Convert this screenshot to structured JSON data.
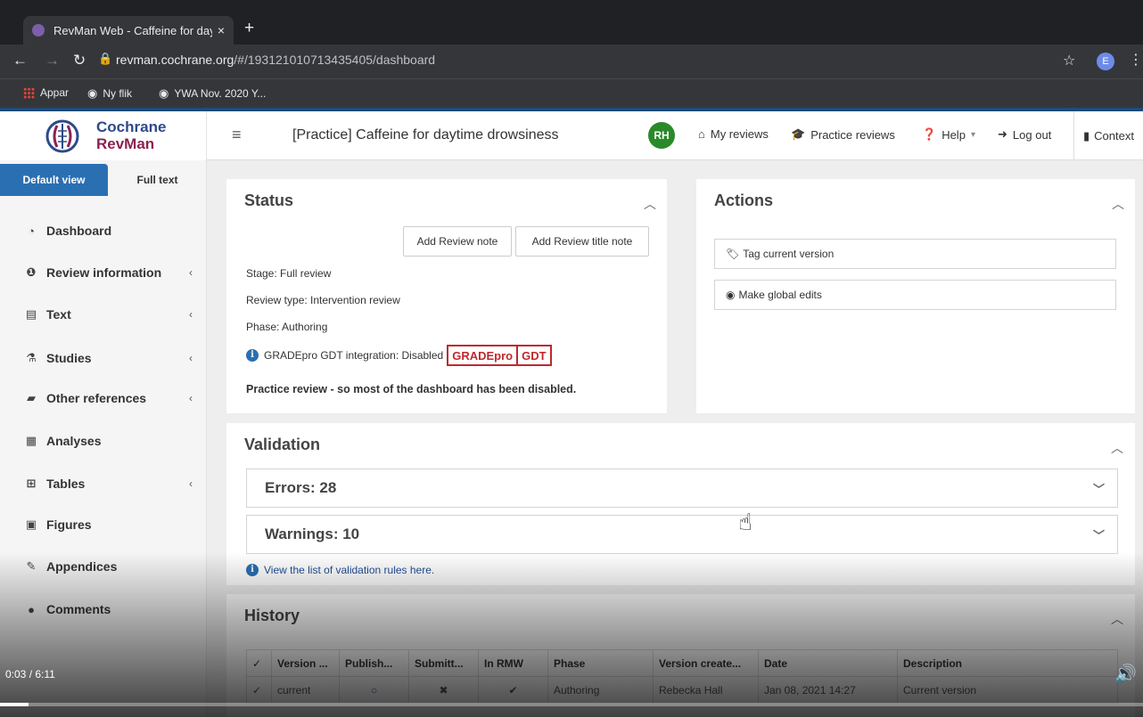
{
  "browser": {
    "tab_title": "RevMan Web - Caffeine for day",
    "tab_close": "×",
    "new_tab": "+",
    "url_host": "revman.cochrane.org",
    "url_path": "/#/193121010713435405/dashboard",
    "profile_initial": "E",
    "bookmarks": [
      "Appar",
      "Ny flik",
      "YWA Nov. 2020 Y..."
    ]
  },
  "header": {
    "logo_line1": "Cochrane",
    "logo_line2": "RevMan",
    "review_title": "[Practice] Caffeine for daytime drowsiness",
    "user_initials": "RH",
    "nav": {
      "my_reviews": "My reviews",
      "practice_reviews": "Practice reviews",
      "help": "Help",
      "logout": "Log out",
      "context": "Context"
    }
  },
  "sidebar": {
    "view_default": "Default view",
    "view_full": "Full text",
    "items": [
      {
        "label": "Dashboard",
        "icon": "dashboard-icon",
        "chevron": false
      },
      {
        "label": "Review information",
        "icon": "info-icon",
        "chevron": true
      },
      {
        "label": "Text",
        "icon": "file-icon",
        "chevron": true
      },
      {
        "label": "Studies",
        "icon": "flask-icon",
        "chevron": true
      },
      {
        "label": "Other references",
        "icon": "book-icon",
        "chevron": true
      },
      {
        "label": "Analyses",
        "icon": "calculator-icon",
        "chevron": false
      },
      {
        "label": "Tables",
        "icon": "table-icon",
        "chevron": true
      },
      {
        "label": "Figures",
        "icon": "image-icon",
        "chevron": false
      },
      {
        "label": "Appendices",
        "icon": "paperclip-icon",
        "chevron": false
      },
      {
        "label": "Comments",
        "icon": "comment-icon",
        "chevron": false
      }
    ]
  },
  "status": {
    "title": "Status",
    "add_note": "Add Review note",
    "add_title_note": "Add Review title note",
    "stage": "Stage: Full review",
    "review_type": "Review type: Intervention review",
    "phase": "Phase: Authoring",
    "gradepro": "GRADEpro GDT integration: Disabled",
    "badge_left": "GRADEpro",
    "badge_right": "GDT",
    "practice_note": "Practice review - so most of the dashboard has been disabled."
  },
  "actions": {
    "title": "Actions",
    "tag": "Tag current version",
    "global_edits": "Make global edits"
  },
  "validation": {
    "title": "Validation",
    "errors": "Errors: 28",
    "warnings": "Warnings: 10",
    "link": "View the list of validation rules here."
  },
  "history": {
    "title": "History",
    "columns": [
      "Version ...",
      "Publish...",
      "Submitt...",
      "In RMW",
      "Phase",
      "Version create...",
      "Date",
      "Description"
    ],
    "rows": [
      [
        "current",
        "○",
        "✖",
        "✔",
        "Authoring",
        "Rebecka Hall",
        "Jan 08, 2021 14:27",
        "Current version"
      ]
    ]
  },
  "video": {
    "time": "0:03 / 6:11",
    "progress": 0.025
  }
}
